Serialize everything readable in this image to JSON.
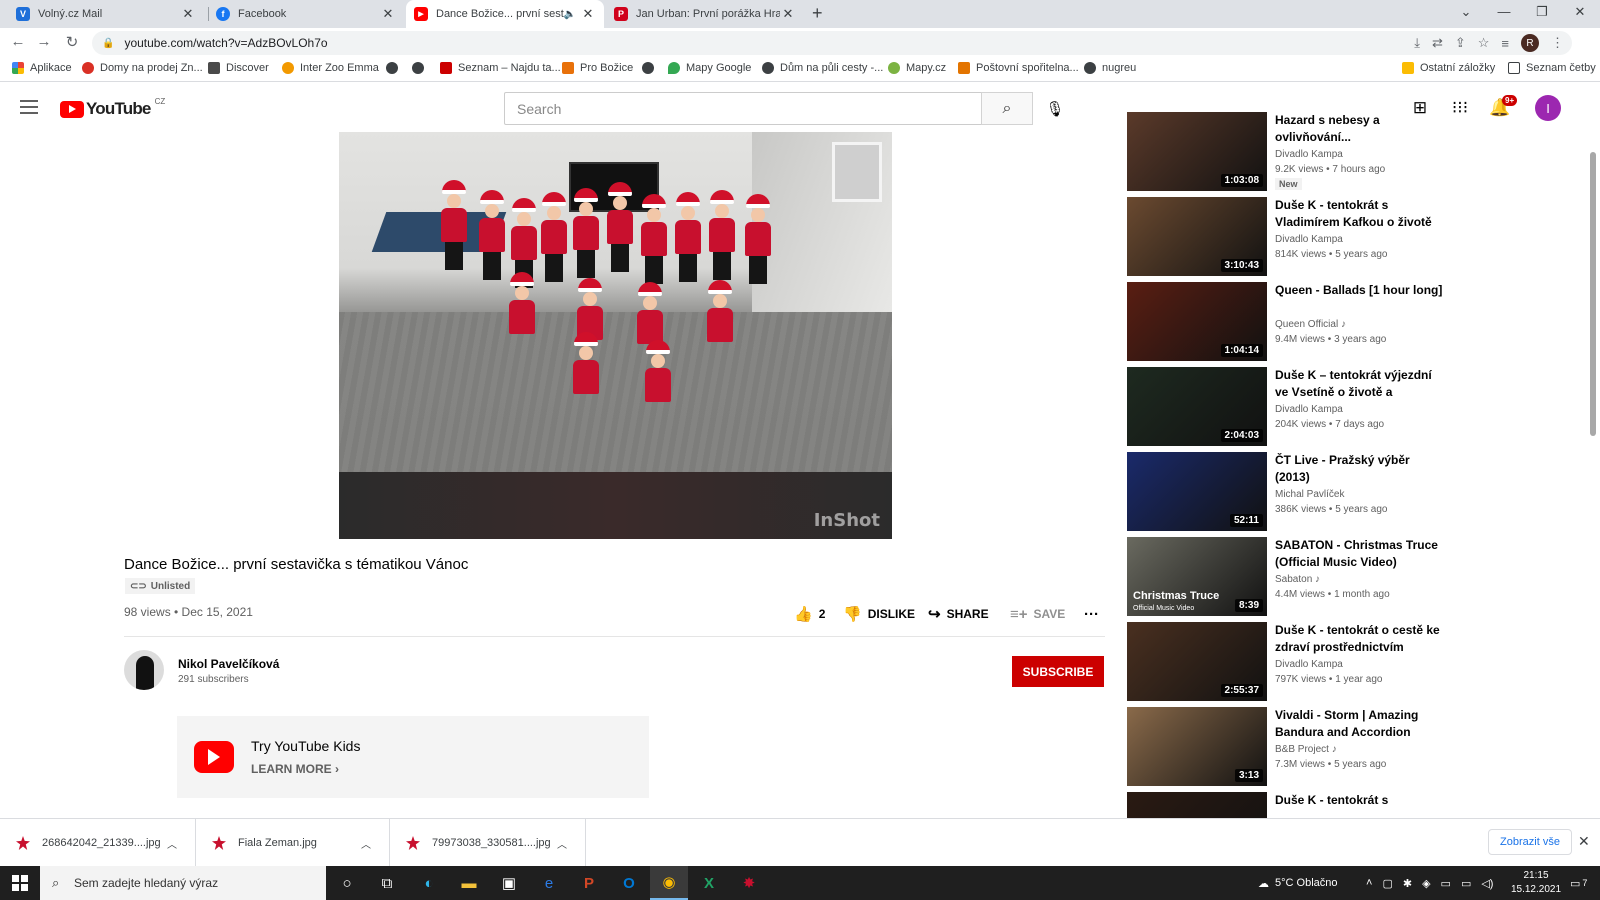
{
  "browser": {
    "tabs": [
      {
        "title": "Volný.cz Mail",
        "favicon": "V",
        "color": "#1e6fd9"
      },
      {
        "title": "Facebook",
        "favicon": "f",
        "color": "#1877f2"
      },
      {
        "title": "Dance Božice... první sestavič",
        "favicon": "▶",
        "color": "#ff0000"
      },
      {
        "title": "Jan Urban: První porážka Hradu j",
        "favicon": "P",
        "color": "#d0021b"
      }
    ],
    "url": "youtube.com/watch?v=AdzBOvLOh7o",
    "bookmarks": [
      {
        "label": "Aplikace",
        "color": "#ea4335"
      },
      {
        "label": "Domy na prodej Zn...",
        "color": "#d93025"
      },
      {
        "label": "Discover",
        "color": "#4a4a4a"
      },
      {
        "label": "Inter Zoo Emma",
        "color": "#f29900"
      },
      {
        "label": "",
        "color": "#3c4043"
      },
      {
        "label": "",
        "color": "#3c4043"
      },
      {
        "label": "Seznam – Najdu ta...",
        "color": "#cc0000"
      },
      {
        "label": "Pro Božice",
        "color": "#e8710a"
      },
      {
        "label": "",
        "color": "#3c4043"
      },
      {
        "label": "Mapy Google",
        "color": "#34a853"
      },
      {
        "label": "Dům na půli cesty -...",
        "color": "#3c4043"
      },
      {
        "label": "Mapy.cz",
        "color": "#7cb342"
      },
      {
        "label": "Poštovní spořitelna...",
        "color": "#e37400"
      },
      {
        "label": "nugreu",
        "color": "#3c4043"
      }
    ],
    "other_bookmarks": "Ostatní záložky",
    "reading_list": "Seznam četby",
    "profile_initial": "R"
  },
  "youtube": {
    "logo_text": "YouTube",
    "country": "CZ",
    "search_placeholder": "Search",
    "notif_count": "9+",
    "avatar_initial": "I",
    "video": {
      "watermark": "InShot",
      "title": "Dance Božice... první sestavička s tématikou Vánoc",
      "unlisted": "Unlisted",
      "meta": "98 views • Dec 15, 2021",
      "likes": "2",
      "dislike": "DISLIKE",
      "share": "SHARE",
      "save": "SAVE"
    },
    "channel": {
      "name": "Nikol Pavelčíková",
      "subs": "291 subscribers",
      "subscribe": "SUBSCRIBE"
    },
    "kids": {
      "title": "Try YouTube Kids",
      "learn": "LEARN MORE"
    },
    "recommendations": [
      {
        "title": "Hazard s nebesy a ovlivňování...",
        "channel": "Divadlo Kampa",
        "meta": "9.2K views • 7 hours ago",
        "duration": "1:03:08",
        "badge": "New",
        "bg": "#5b3a2a"
      },
      {
        "title": "Duše K - tentokrát s Vladimírem Kafkou o životě naživo -...",
        "channel": "Divadlo Kampa",
        "meta": "814K views • 5 years ago",
        "duration": "3:10:43",
        "bg": "#6b4a30"
      },
      {
        "title": "Queen - Ballads [1 hour long]",
        "channel": "Queen Official ♪",
        "meta": "9.4M views • 3 years ago",
        "duration": "1:04:14",
        "bg": "#5a1e12"
      },
      {
        "title": "Duše K – tentokrát výjezdní ve Vsetíně o životě a vzdělávání s...",
        "channel": "Divadlo Kampa",
        "meta": "204K views • 7 days ago",
        "duration": "2:04:03",
        "bg": "#1e2a20"
      },
      {
        "title": "ČT Live - Pražský výběr (2013)",
        "channel": "Michal Pavlíček",
        "meta": "386K views • 5 years ago",
        "duration": "52:11",
        "bg": "#1a2a6b"
      },
      {
        "title": "SABATON - Christmas Truce (Official Music Video)",
        "channel": "Sabaton ♪",
        "meta": "4.4M views • 1 month ago",
        "duration": "8:39",
        "thumb_text": "Christmas Truce",
        "thumb_sub": "Official Music Video",
        "bg": "#6a6a60"
      },
      {
        "title": "Duše K - tentokrát o cestě ke zdraví prostřednictvím učení...",
        "channel": "Divadlo Kampa",
        "meta": "797K views • 1 year ago",
        "duration": "2:55:37",
        "bg": "#4a3020"
      },
      {
        "title": "Vivaldi - Storm | Amazing Bandura and Accordion Cover!!!",
        "channel": "B&B Project ♪",
        "meta": "7.3M views • 5 years ago",
        "duration": "3:13",
        "bg": "#8a6a4a"
      },
      {
        "title": "Duše K - tentokrát s",
        "channel": "",
        "meta": "",
        "duration": "",
        "bg": "#2a1a12"
      }
    ]
  },
  "downloads": {
    "items": [
      "268642042_21339....jpg",
      "Fiala Zeman.jpg",
      "79973038_330581....jpg"
    ],
    "show_all": "Zobrazit vše"
  },
  "taskbar": {
    "search_placeholder": "Sem zadejte hledaný výraz",
    "weather": "5°C Oblačno",
    "time": "21:15",
    "date": "15.12.2021",
    "notif_count": "7"
  }
}
